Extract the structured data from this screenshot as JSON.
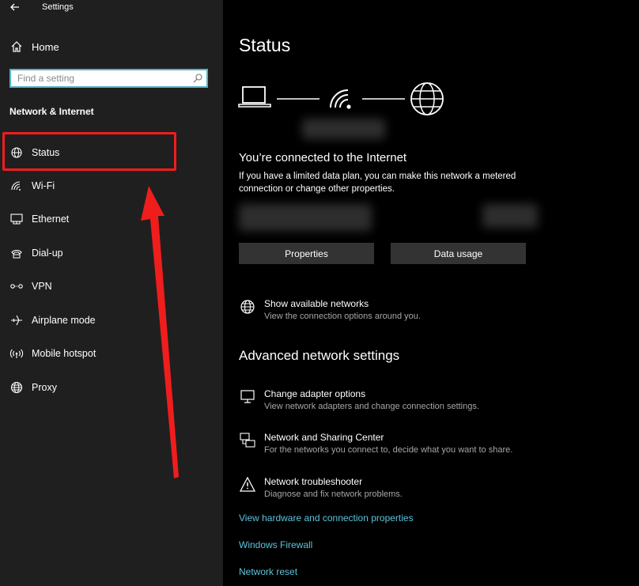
{
  "window": {
    "title": "Settings"
  },
  "sidebar": {
    "home_label": "Home",
    "search_placeholder": "Find a setting",
    "section_title": "Network & Internet",
    "items": [
      {
        "label": "Status",
        "icon": "globe-status-icon"
      },
      {
        "label": "Wi-Fi",
        "icon": "wifi-icon"
      },
      {
        "label": "Ethernet",
        "icon": "ethernet-icon"
      },
      {
        "label": "Dial-up",
        "icon": "dial-up-icon"
      },
      {
        "label": "VPN",
        "icon": "vpn-icon"
      },
      {
        "label": "Airplane mode",
        "icon": "airplane-icon"
      },
      {
        "label": "Mobile hotspot",
        "icon": "hotspot-icon"
      },
      {
        "label": "Proxy",
        "icon": "globe-icon"
      }
    ]
  },
  "main": {
    "title": "Status",
    "connected_title": "You’re connected to the Internet",
    "connected_desc": "If you have a limited data plan, you can make this network a metered connection or change other properties.",
    "buttons": {
      "properties": "Properties",
      "data_usage": "Data usage"
    },
    "show_networks": {
      "title": "Show available networks",
      "subtitle": "View the connection options around you."
    },
    "advanced_title": "Advanced network settings",
    "advanced_items": [
      {
        "title": "Change adapter options",
        "subtitle": "View network adapters and change connection settings."
      },
      {
        "title": "Network and Sharing Center",
        "subtitle": "For the networks you connect to, decide what you want to share."
      },
      {
        "title": "Network troubleshooter",
        "subtitle": "Diagnose and fix network problems."
      }
    ],
    "links": [
      "View hardware and connection properties",
      "Windows Firewall",
      "Network reset"
    ]
  },
  "colors": {
    "accent_link": "#5cc4dc",
    "highlight": "#f01d1d",
    "sidebar_bg": "#1f1f1f",
    "button_bg": "#333333"
  }
}
